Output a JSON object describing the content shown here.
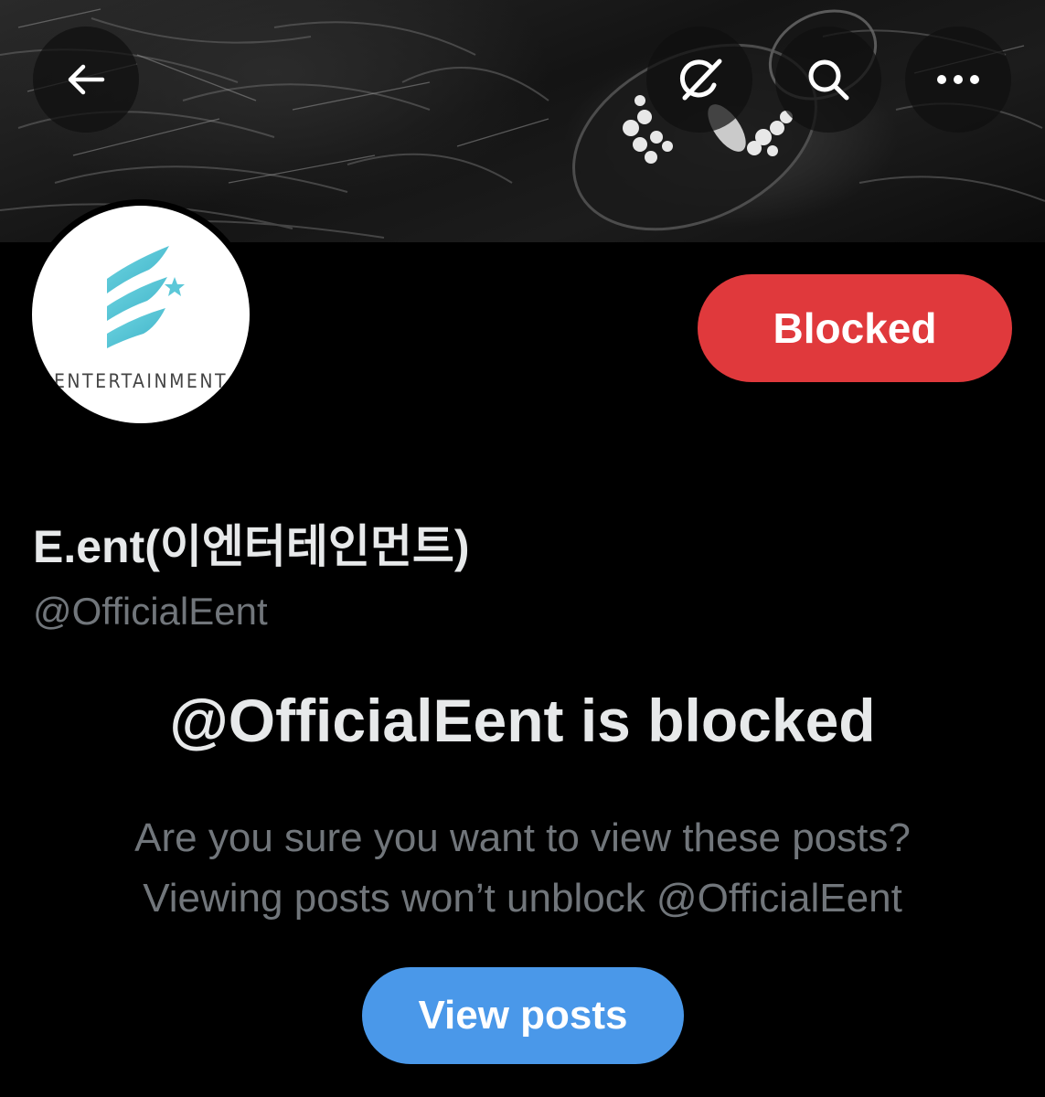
{
  "header": {
    "back_icon": "arrow-left-icon",
    "grok_icon": "grok-icon",
    "search_icon": "search-icon",
    "more_icon": "more-horizontal-icon"
  },
  "profile": {
    "avatar_text": "ENTERTAINMENT",
    "display_name": "E.ent(이엔터테인먼트)",
    "handle": "@OfficialEent",
    "status_button_label": "Blocked"
  },
  "blocked_notice": {
    "title": "@OfficialEent is blocked",
    "line1": "Are you sure you want to view these posts?",
    "line2": "Viewing posts won’t unblock @OfficialEent",
    "button_label": "View posts"
  },
  "colors": {
    "background": "#000000",
    "blocked_button": "#e0393c",
    "view_posts_button": "#4a98e9",
    "secondary_text": "#71767b",
    "primary_text": "#e7e9ea",
    "logo_accent": "#5cc8d8"
  }
}
